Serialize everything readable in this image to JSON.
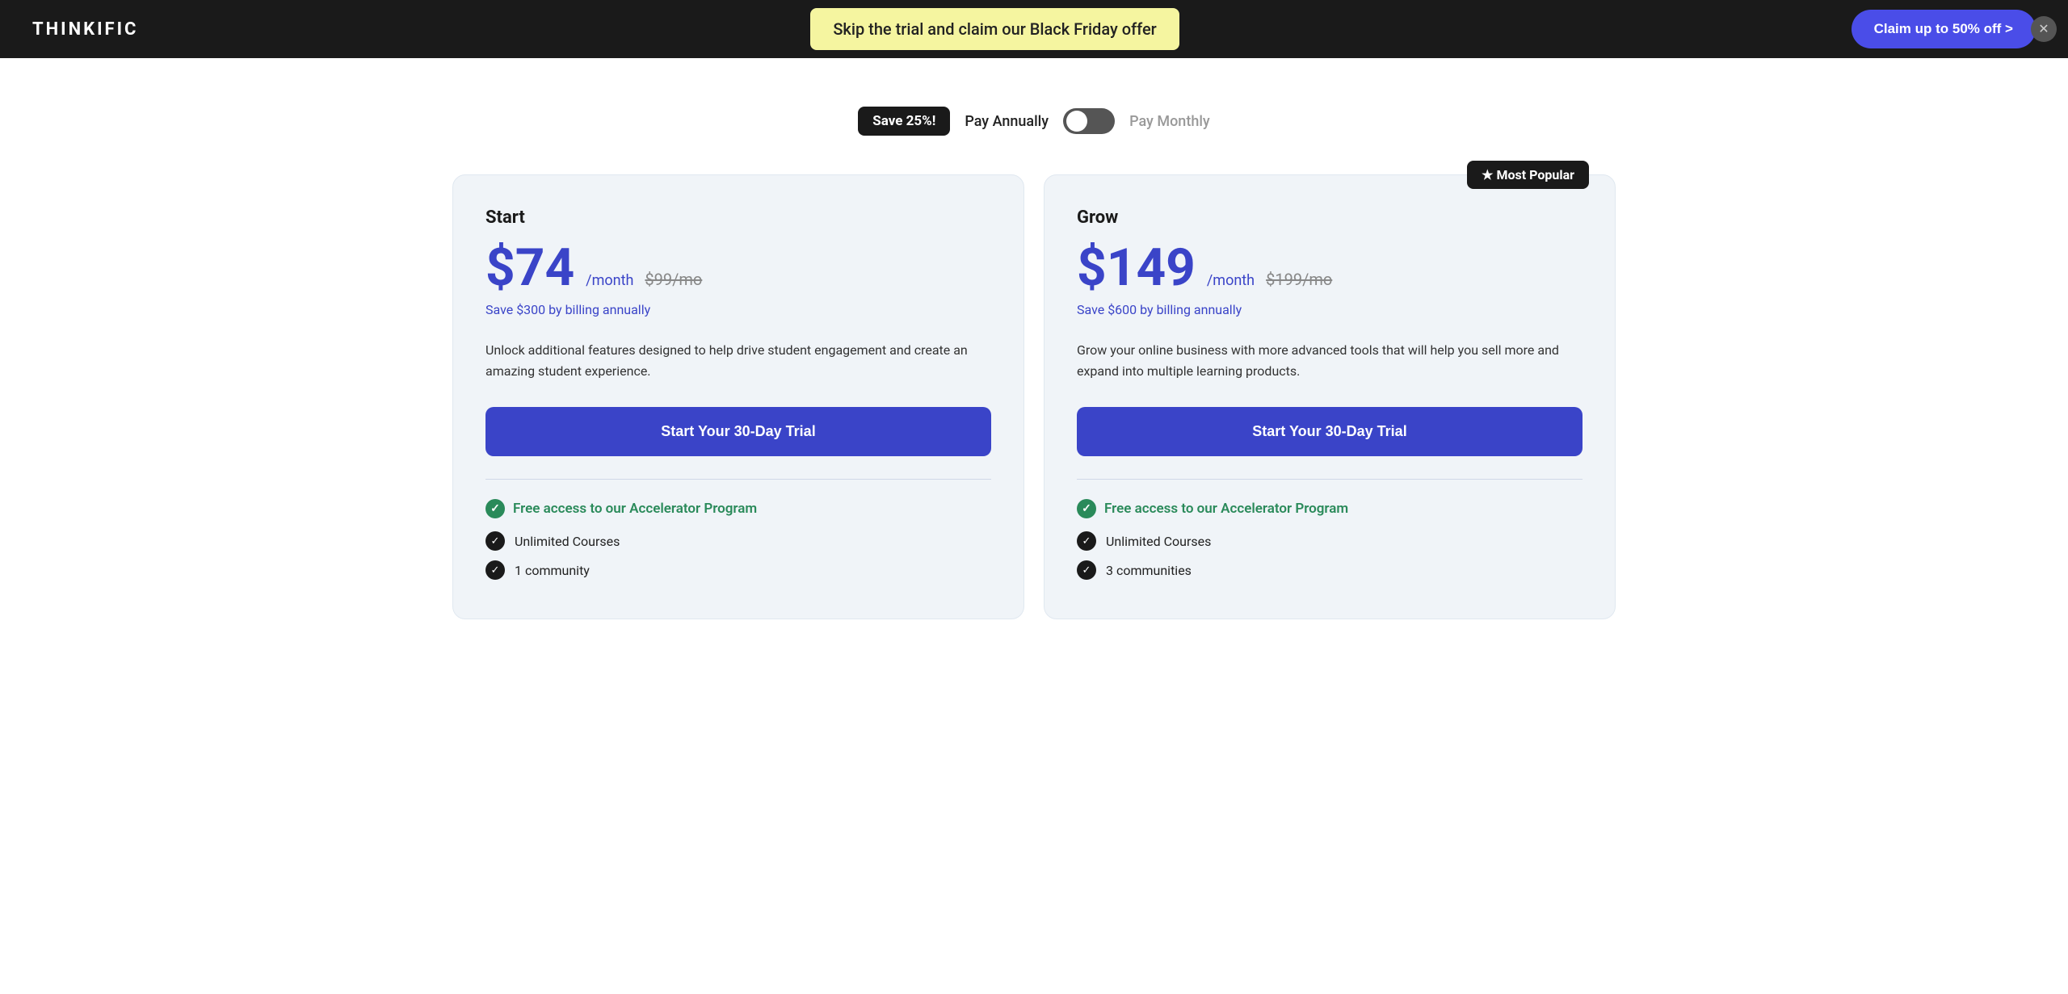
{
  "navbar": {
    "logo": "THINKIFIC",
    "banner_text": "Skip the trial and claim our Black Friday offer",
    "cta_label": "Claim up to 50% off >",
    "close_icon": "✕"
  },
  "billing": {
    "save_badge": "Save 25%!",
    "annually_label": "Pay Annually",
    "monthly_label": "Pay Monthly"
  },
  "plans": [
    {
      "id": "start",
      "name": "Start",
      "price": "$74",
      "per_month": "/month",
      "original_price": "$99/mo",
      "save_text": "Save $300 by billing annually",
      "description": "Unlock additional features designed to help drive student engagement and create an amazing student experience.",
      "trial_button": "Start Your 30-Day Trial",
      "accelerator_label": "Free access to our Accelerator Program",
      "features": [
        "Unlimited Courses",
        "1 community"
      ],
      "most_popular": false
    },
    {
      "id": "grow",
      "name": "Grow",
      "price": "$149",
      "per_month": "/month",
      "original_price": "$199/mo",
      "save_text": "Save $600 by billing annually",
      "description": "Grow your online business with more advanced tools that will help you sell more and expand into multiple learning products.",
      "trial_button": "Start Your 30-Day Trial",
      "accelerator_label": "Free access to our Accelerator Program",
      "features": [
        "Unlimited Courses",
        "3 communities"
      ],
      "most_popular": true
    }
  ]
}
